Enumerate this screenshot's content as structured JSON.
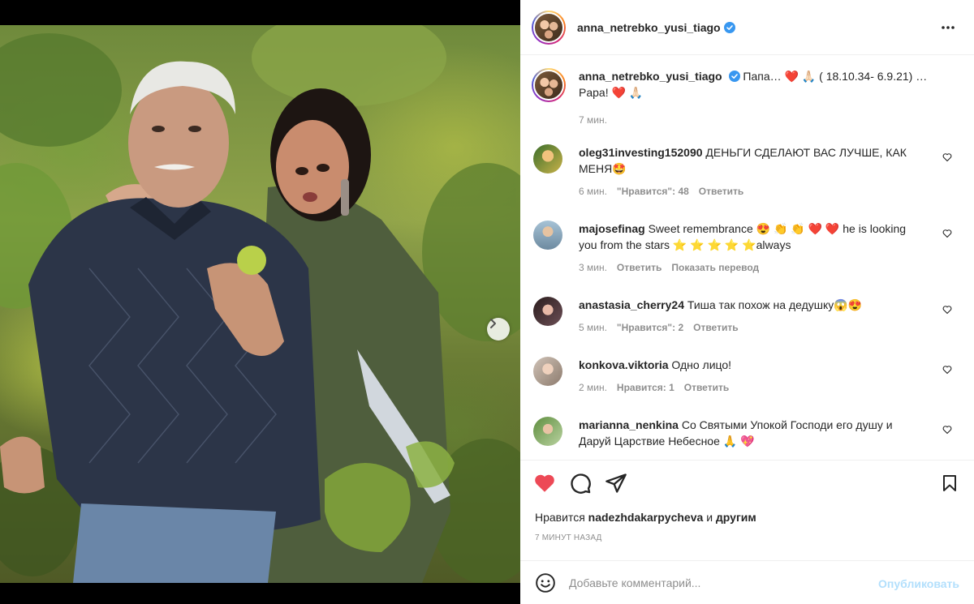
{
  "post": {
    "author": "anna_netrebko_yusi_tiago",
    "caption_text": "Папа… ❤️ 🙏🏻 ( 18.10.34- 6.9.21) … Papa! ❤️ 🙏🏻",
    "caption_time": "7 мин.",
    "carousel_count": 5,
    "carousel_active": 1
  },
  "comments": [
    {
      "user": "oleg31investing152090",
      "text": "ДЕНЬГИ СДЕЛАЮТ ВАС ЛУЧШЕ, КАК МЕНЯ🤩",
      "time": "6 мин.",
      "likes": "\"Нравится\": 48",
      "reply": "Ответить",
      "extra": ""
    },
    {
      "user": "majosefinag",
      "text": "Sweet remembrance 😍 👏 👏 ❤️ ❤️ he is looking you from the stars ⭐ ⭐ ⭐ ⭐ ⭐always",
      "time": "3 мин.",
      "likes": "",
      "reply": "Ответить",
      "extra": "Показать перевод"
    },
    {
      "user": "anastasia_cherry24",
      "text": "Тиша так похож на дедушку😱😍",
      "time": "5 мин.",
      "likes": "\"Нравится\": 2",
      "reply": "Ответить",
      "extra": ""
    },
    {
      "user": "konkova.viktoria",
      "text": "Одно лицо!",
      "time": "2 мин.",
      "likes": "Нравится: 1",
      "reply": "Ответить",
      "extra": ""
    },
    {
      "user": "marianna_nenkina",
      "text": "Со Святыми Упокой Господи его душу и Даруй Царствие Небесное 🙏 💖",
      "time": "",
      "likes": "",
      "reply": "",
      "extra": ""
    }
  ],
  "likes_line": {
    "prefix": "Нравится",
    "user": "nadezhdakarpycheva",
    "joiner": "и",
    "suffix": "другим"
  },
  "time_ago": "7 МИНУТ НАЗАД",
  "add_comment": {
    "placeholder": "Добавьте комментарий...",
    "publish": "Опубликовать"
  },
  "icons": {
    "like": "heart-filled-icon",
    "comment": "speech-bubble-icon",
    "share": "paper-plane-icon",
    "save": "bookmark-icon",
    "more": "ellipsis-icon",
    "emoji": "smiley-icon",
    "next": "chevron-right-icon"
  },
  "colors": {
    "like_red": "#ed4956",
    "verified_blue": "#3897f0",
    "publish_disabled": "#b2dffc"
  }
}
